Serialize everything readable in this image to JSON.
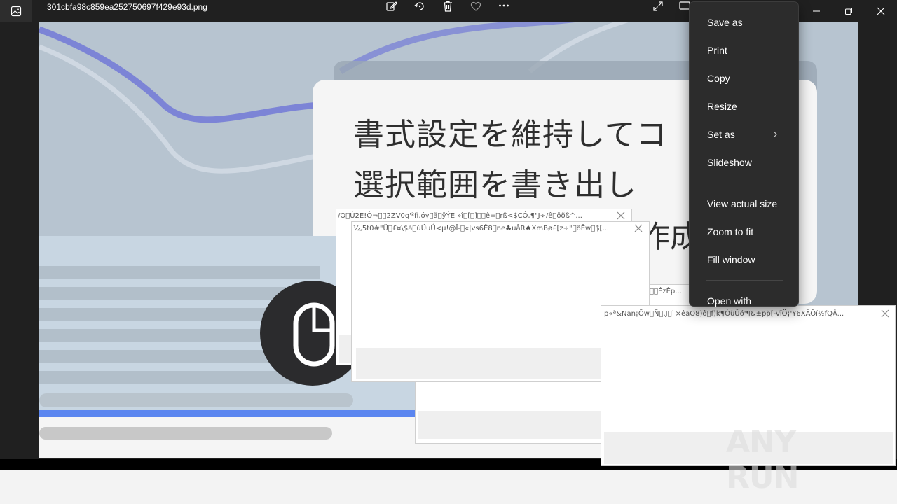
{
  "titlebar": {
    "filename": "301cbfa98c859ea252750697f429e93d.png",
    "tools": [
      "edit-icon",
      "rotate-icon",
      "delete-icon",
      "favorite-icon",
      "more-icon"
    ],
    "right_tools": [
      "fullscreen-icon",
      "crop-icon"
    ],
    "window_controls": [
      "minimize-icon",
      "restore-icon",
      "close-icon"
    ]
  },
  "photo": {
    "line1": "書式設定を維持してコ",
    "line2": "選択範囲を書き出し",
    "line3": "作成"
  },
  "menu": {
    "items": [
      "Save as",
      "Print",
      "Copy",
      "Resize",
      "Set as",
      "Slideshow",
      "View actual size",
      "Zoom to fit",
      "Fill window",
      "Open with"
    ],
    "submenu_arrow": "›"
  },
  "dialogs": [
    {
      "title": "/O\u0000Ù2E!Ò¬\u0000\u00002ZV0q'²fi,óγ\u0000ã\u0000ÿÝE »î\u0000[\u0000]\u0000\u0000ê=\u0000rß<$CÓ,¶\"J÷/ê\u0000öðß^..."
    },
    {
      "title": "½,5t0#\"Ü\u0000£¤\\$à\u0000ùÜuÚ<µ!@Î-\u0000«|vs6Ê8\u0000ne♣uåR♠XmBø£[z÷\"\u0000õÊw\u0000$[..."
    },
    {
      "title": "\u0000\u0000ÉzÊp..."
    },
    {
      "title": "p«ª&Nan¡Õw\u0000Ñ\u0000.J\u0000`×êaO8)ô\u0000f)k¶ÒùÛó'¶&±pþ[-vïÖ¡'Y6XÄÕï½fQÂ..."
    }
  ],
  "watermark": "ANY RUN",
  "colors": {
    "menu_bg": "#2c2c2c",
    "titlebar_bg": "#202020",
    "accent_line": "#6a73d6"
  }
}
